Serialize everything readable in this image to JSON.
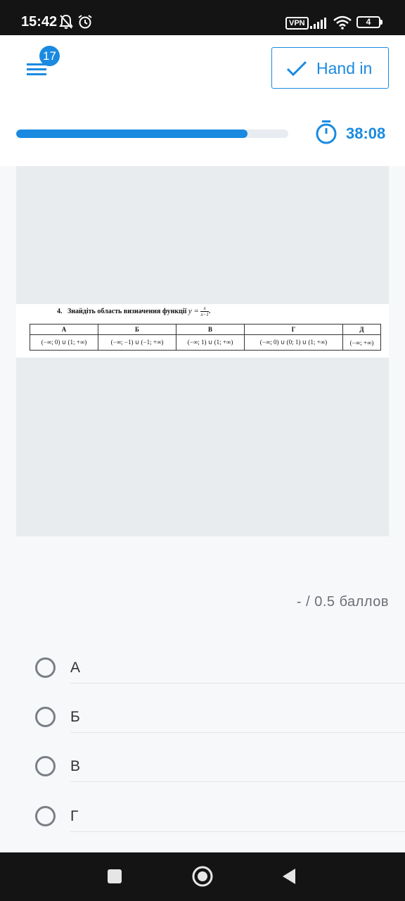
{
  "status_bar": {
    "time": "15:42",
    "vpn_label": "VPN",
    "battery_level": "4"
  },
  "header": {
    "menu_badge_count": "17",
    "hand_in_label": "Hand in",
    "progress_fraction": 0.85,
    "timer": "38:08",
    "accent_color": "#1a8ae0"
  },
  "question": {
    "number": "4.",
    "prompt": "Знайдіть область визначення функції",
    "function_lhs": "y =",
    "fraction_num": "x",
    "fraction_den": "x−1",
    "trailing": ".",
    "table": {
      "headers": [
        "А",
        "Б",
        "В",
        "Г",
        "Д"
      ],
      "cells": [
        "(−∞; 0) ∪ (1; +∞)",
        "(−∞; −1) ∪ (−1; +∞)",
        "(−∞; 1) ∪ (1; +∞)",
        "(−∞; 0) ∪ (0; 1) ∪ (1; +∞)",
        "(−∞; +∞)"
      ]
    }
  },
  "score": "-  /  0.5  баллов",
  "options": [
    {
      "label": "А"
    },
    {
      "label": "Б"
    },
    {
      "label": "В"
    },
    {
      "label": "Г"
    }
  ]
}
